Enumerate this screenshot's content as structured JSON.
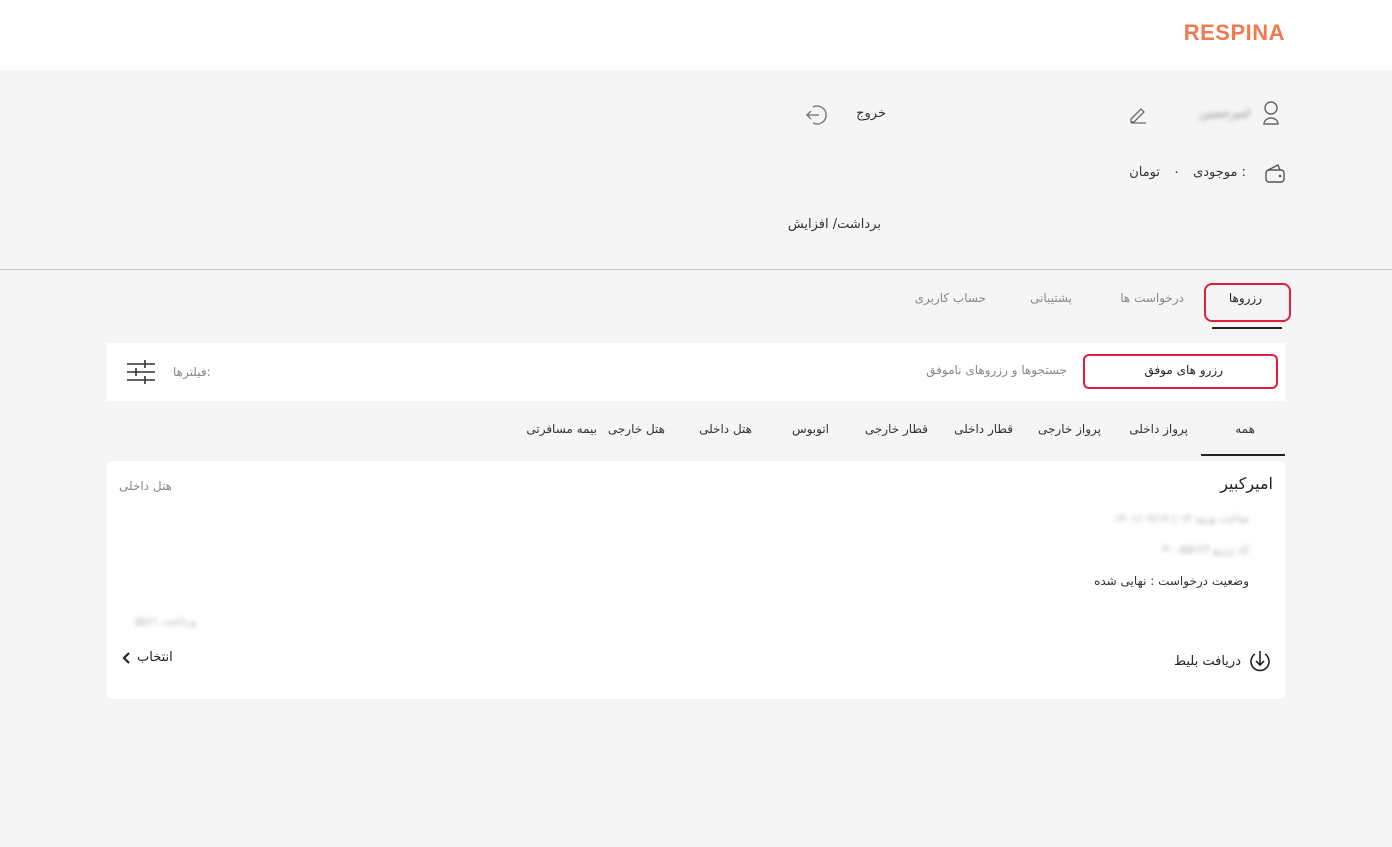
{
  "header": {
    "logo": "RESPINA"
  },
  "profile": {
    "username": "امیرحسین",
    "logout_label": "خروج",
    "balance_label": "موجودی :",
    "balance_value": "۰",
    "balance_unit": "تومان",
    "withdraw_label": "برداشت/ افزایش"
  },
  "tabs": [
    {
      "label": "رزروها"
    },
    {
      "label": "درخواست ها"
    },
    {
      "label": "پشتیبانی"
    },
    {
      "label": "حساب کاربری"
    }
  ],
  "subtabs": {
    "successful": "رزرو های موفق",
    "failed": "جستجوها و رزروهای ناموفق",
    "filters_label": "فیلترها:"
  },
  "categories": [
    {
      "label": "همه"
    },
    {
      "label": "پرواز داخلی"
    },
    {
      "label": "پرواز خارجی"
    },
    {
      "label": "قطار داخلی"
    },
    {
      "label": "قطار خارجی"
    },
    {
      "label": "اتوبوس"
    },
    {
      "label": "هتل داخلی"
    },
    {
      "label": "هتل خارجی"
    },
    {
      "label": "بیمه مسافرتی"
    }
  ],
  "booking": {
    "title": "امیرکبیر",
    "type": "هتل داخلی",
    "date_line": "۱۴۰۱/۰۹/۱۷ | ساعت ورود ۱۴",
    "code_line": "کد رزرو ۳۰۰۵۵۲۶۳",
    "status": "وضعیت درخواست : نهایی شده",
    "price": "۵۵۶۱ پرداخت",
    "download_label": "دریافت بلیط",
    "select_label": "انتخاب"
  },
  "colors": {
    "accent": "#ef7b4e",
    "highlight": "#e01f3d"
  }
}
